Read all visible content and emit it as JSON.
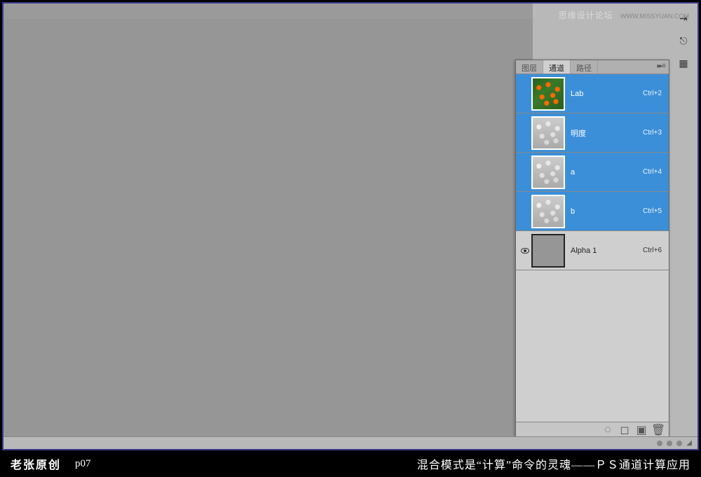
{
  "watermark": {
    "text": "思缘设计论坛",
    "url": "WWW.MISSYUAN.COM"
  },
  "panel": {
    "tabs": {
      "layers": "图层",
      "channels": "通道",
      "paths": "路径"
    },
    "menu_glyph": "▸▸ ≡",
    "channels": [
      {
        "name": "Lab",
        "shortcut": "Ctrl+2",
        "selected": true,
        "thumb": "lab",
        "visible": false
      },
      {
        "name": "明度",
        "shortcut": "Ctrl+3",
        "selected": true,
        "thumb": "gray",
        "visible": false
      },
      {
        "name": "a",
        "shortcut": "Ctrl+4",
        "selected": true,
        "thumb": "gray",
        "visible": false
      },
      {
        "name": "b",
        "shortcut": "Ctrl+5",
        "selected": true,
        "thumb": "gray",
        "visible": false
      },
      {
        "name": "Alpha 1",
        "shortcut": "Ctrl+6",
        "selected": false,
        "thumb": "solid",
        "visible": true
      }
    ]
  },
  "caption": {
    "author": "老张原创",
    "page": "p07",
    "title": "混合模式是“计算”命令的灵魂——ＰＳ通道计算应用"
  }
}
